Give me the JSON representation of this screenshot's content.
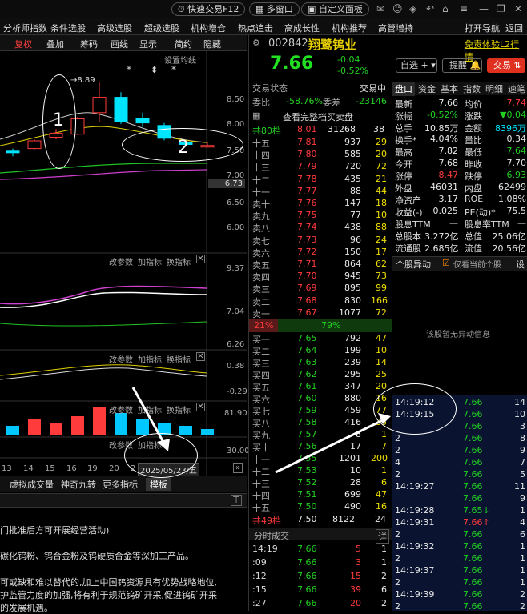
{
  "topbar": {
    "fast_trade": "快速交易F12",
    "multi_window": "多窗口",
    "custom_panel": "自定义面板"
  },
  "menu": [
    "分析师指数",
    "条件选股",
    "高级选股",
    "超级选股",
    "机构增仓",
    "热点追击",
    "高成长性",
    "机构推荐",
    "高管增持",
    "打开导航",
    "返回"
  ],
  "chart_toolbar": {
    "adjust": "复权",
    "overlay": "叠加",
    "chips": "筹码",
    "draw": "画线",
    "display": "显示",
    "tick": "简约",
    "hide": "隐藏"
  },
  "chart": {
    "settings_label": "设置均线",
    "high_tag": "8.89",
    "price_ticks": [
      "8.50",
      "8.00",
      "7.50",
      "7.00",
      "6.73",
      "6.50",
      "6.00"
    ],
    "panel2_ticks": [
      "9.37",
      "7.04",
      "6.26"
    ],
    "panel3_ticks": [
      "0.38",
      "-0.29"
    ],
    "panel4_ticks": [
      "81.90",
      "30.00"
    ],
    "panel_controls": {
      "params": "改参数",
      "add": "加指标",
      "switch": "换指标"
    },
    "x_labels": [
      "13",
      "14",
      "15",
      "16",
      "19",
      "20",
      "2"
    ],
    "date_tag": "2025/05/23/五",
    "candles": [
      {
        "o": 7.55,
        "h": 7.6,
        "l": 7.45,
        "c": 7.52
      },
      {
        "o": 7.6,
        "h": 7.78,
        "l": 7.58,
        "c": 7.75
      },
      {
        "o": 7.82,
        "h": 7.98,
        "l": 7.78,
        "c": 7.9
      },
      {
        "o": 7.88,
        "h": 8.22,
        "l": 7.86,
        "c": 8.18
      },
      {
        "o": 8.3,
        "h": 8.89,
        "l": 8.12,
        "c": 8.6
      },
      {
        "o": 8.6,
        "h": 8.7,
        "l": 8.08,
        "c": 8.12
      },
      {
        "o": 8.18,
        "h": 8.3,
        "l": 8.02,
        "c": 8.1
      },
      {
        "o": 8.05,
        "h": 8.1,
        "l": 7.76,
        "c": 7.8
      },
      {
        "o": 7.72,
        "h": 7.76,
        "l": 7.64,
        "c": 7.68
      },
      {
        "o": 7.66,
        "h": 7.72,
        "l": 7.62,
        "c": 7.66
      }
    ],
    "volumes": [
      3,
      5,
      4,
      6,
      9,
      7,
      5,
      4,
      3,
      2
    ],
    "vol_up": [
      0,
      1,
      1,
      1,
      1,
      0,
      0,
      0,
      0,
      0
    ]
  },
  "bottom_tabs": [
    "虚拟成交量",
    "神奇九转",
    "更多指标",
    "模板"
  ],
  "info_lines": [
    "门批准后方可开展经营活动)",
    "碳化钨粉、钨合金粉及钨硬质合金等深加工产品。",
    "可或缺和难以替代的,加上中国钨资源具有优势战略地位,",
    "护监管力度的加强,将有利于规范钨矿开采,促进钨矿开采",
    "的发展机遇。"
  ],
  "quote": {
    "code": "002842",
    "name": "翔鹭钨业",
    "disclaimer": "免责体验L2行情",
    "price": "7.66",
    "change": "-0.04",
    "change_pct": "-0.52%",
    "watch": "自选",
    "alert": "提醒",
    "trade": "交易",
    "status_label": "交易状态",
    "status_value": "交易中",
    "wb_label": "委比",
    "wb_value": "-58.76%",
    "wc_label": "委差",
    "wc_value": "-23146",
    "full_book": "查看完整档买卖盘",
    "ask_total": {
      "label": "共80档",
      "price": "8.01",
      "vol": "31268",
      "n": "38"
    },
    "bid_total": {
      "label": "共49档",
      "price": "7.50",
      "vol": "8122",
      "n": "24"
    },
    "ratio_left": "21%",
    "ratio_right": "79%"
  },
  "asks": [
    {
      "l": "十五",
      "p": "7.81",
      "v": "937",
      "n": "29"
    },
    {
      "l": "十四",
      "p": "7.80",
      "v": "585",
      "n": "20"
    },
    {
      "l": "十三",
      "p": "7.79",
      "v": "720",
      "n": "72"
    },
    {
      "l": "十二",
      "p": "7.78",
      "v": "435",
      "n": "21"
    },
    {
      "l": "十一",
      "p": "7.77",
      "v": "88",
      "n": "44"
    },
    {
      "l": "卖十",
      "p": "7.76",
      "v": "147",
      "n": "18"
    },
    {
      "l": "卖九",
      "p": "7.75",
      "v": "77",
      "n": "10"
    },
    {
      "l": "卖八",
      "p": "7.74",
      "v": "438",
      "n": "88"
    },
    {
      "l": "卖七",
      "p": "7.73",
      "v": "96",
      "n": "24"
    },
    {
      "l": "卖六",
      "p": "7.72",
      "v": "150",
      "n": "17"
    },
    {
      "l": "卖五",
      "p": "7.71",
      "v": "864",
      "n": "62"
    },
    {
      "l": "卖四",
      "p": "7.70",
      "v": "945",
      "n": "73"
    },
    {
      "l": "卖三",
      "p": "7.69",
      "v": "895",
      "n": "99"
    },
    {
      "l": "卖二",
      "p": "7.68",
      "v": "830",
      "n": "166"
    },
    {
      "l": "卖一",
      "p": "7.67",
      "v": "1077",
      "n": "72"
    }
  ],
  "bids": [
    {
      "l": "买一",
      "p": "7.65",
      "v": "792",
      "n": "47"
    },
    {
      "l": "买二",
      "p": "7.64",
      "v": "199",
      "n": "10"
    },
    {
      "l": "买三",
      "p": "7.63",
      "v": "239",
      "n": "14"
    },
    {
      "l": "买四",
      "p": "7.62",
      "v": "295",
      "n": "25"
    },
    {
      "l": "买五",
      "p": "7.61",
      "v": "347",
      "n": "20"
    },
    {
      "l": "买六",
      "p": "7.60",
      "v": "880",
      "n": "16"
    },
    {
      "l": "买七",
      "p": "7.59",
      "v": "459",
      "n": "77"
    },
    {
      "l": "买八",
      "p": "7.58",
      "v": "416",
      "n": "35"
    },
    {
      "l": "买九",
      "p": "7.57",
      "v": "8",
      "n": "1"
    },
    {
      "l": "买十",
      "p": "7.56",
      "v": "17",
      "n": "7"
    },
    {
      "l": "十一",
      "p": "7.55",
      "v": "1201",
      "n": "200"
    },
    {
      "l": "十二",
      "p": "7.53",
      "v": "10",
      "n": "1"
    },
    {
      "l": "十三",
      "p": "7.52",
      "v": "28",
      "n": "6"
    },
    {
      "l": "十四",
      "p": "7.51",
      "v": "699",
      "n": "47"
    },
    {
      "l": "十五",
      "p": "7.50",
      "v": "490",
      "n": "16"
    }
  ],
  "tick_header": {
    "title": "分时成交",
    "detail": "详"
  },
  "mid_ticks": [
    {
      "t": "14:19",
      "p": "7.66",
      "v": "5",
      "n": "1"
    },
    {
      "t": ":09",
      "p": "7.66",
      "v": "3",
      "n": "1"
    },
    {
      "t": ":12",
      "p": "7.66",
      "v": "15",
      "n": "2"
    },
    {
      "t": ":15",
      "p": "7.66",
      "v": "39",
      "n": "6"
    },
    {
      "t": ":27",
      "p": "7.66",
      "v": "20",
      "n": "2"
    }
  ],
  "right_tabs": [
    "盘口",
    "资金",
    "基本",
    "指数",
    "明细",
    "速笔"
  ],
  "stats": [
    [
      "最新",
      "7.66",
      "均价",
      "7.74"
    ],
    [
      "涨幅",
      "-0.52%",
      "涨跌",
      "▼0.04"
    ],
    [
      "总手",
      "10.85万",
      "金额",
      "8396万"
    ],
    [
      "换手*",
      "4.04%",
      "量比",
      "0.34"
    ],
    [
      "最高",
      "7.82",
      "最低",
      "7.64"
    ],
    [
      "今开",
      "7.68",
      "昨收",
      "7.70"
    ],
    [
      "涨停",
      "8.47",
      "跌停",
      "6.93"
    ],
    [
      "外盘",
      "46031",
      "内盘",
      "62499"
    ],
    [
      "净资产",
      "3.17",
      "ROE",
      "1.08%"
    ],
    [
      "收益(-)",
      "0.025",
      "PE(动)*",
      "75.5"
    ],
    [
      "股息TTM",
      "—",
      "股息率TTM",
      "—"
    ],
    [
      "总股本",
      "3.272亿",
      "总值",
      "25.06亿"
    ],
    [
      "流通股",
      "2.685亿",
      "流值",
      "20.56亿"
    ]
  ],
  "abnormal": {
    "title": "个股异动",
    "only_current": "仅看当前个股",
    "settings": "设",
    "empty": "该股暂无异动信息"
  },
  "right_ticks": [
    {
      "t": "14:19:12",
      "p": "7.66",
      "v": "14"
    },
    {
      "t": "14:19:15",
      "p": "7.66",
      "v": "10"
    },
    {
      "t": "",
      "p": "7.66",
      "v": "3"
    },
    {
      "t": "2",
      "p": "7.66",
      "v": "8"
    },
    {
      "t": "2",
      "p": "7.66",
      "v": "9"
    },
    {
      "t": "4",
      "p": "7.66",
      "v": "7"
    },
    {
      "t": "2",
      "p": "7.66",
      "v": "5"
    },
    {
      "t": "14:19:27",
      "p": "7.66",
      "v": "11"
    },
    {
      "t": "",
      "p": "7.66",
      "v": "9"
    },
    {
      "t": "14:19:28",
      "p": "7.65↓",
      "v": "1"
    },
    {
      "t": "14:19:31",
      "p": "7.66↑",
      "v": "4"
    },
    {
      "t": "2",
      "p": "7.66",
      "v": "6"
    },
    {
      "t": "14:19:32",
      "p": "7.66",
      "v": "1"
    },
    {
      "t": "2",
      "p": "7.66",
      "v": "1"
    },
    {
      "t": "14:19:37",
      "p": "7.66",
      "v": "1"
    },
    {
      "t": "2",
      "p": "7.66",
      "v": "1"
    },
    {
      "t": "14:19:39",
      "p": "7.66",
      "v": "2"
    },
    {
      "t": "2",
      "p": "7.66",
      "v": "2"
    }
  ],
  "annotations": {
    "one": "1",
    "two": "2"
  }
}
